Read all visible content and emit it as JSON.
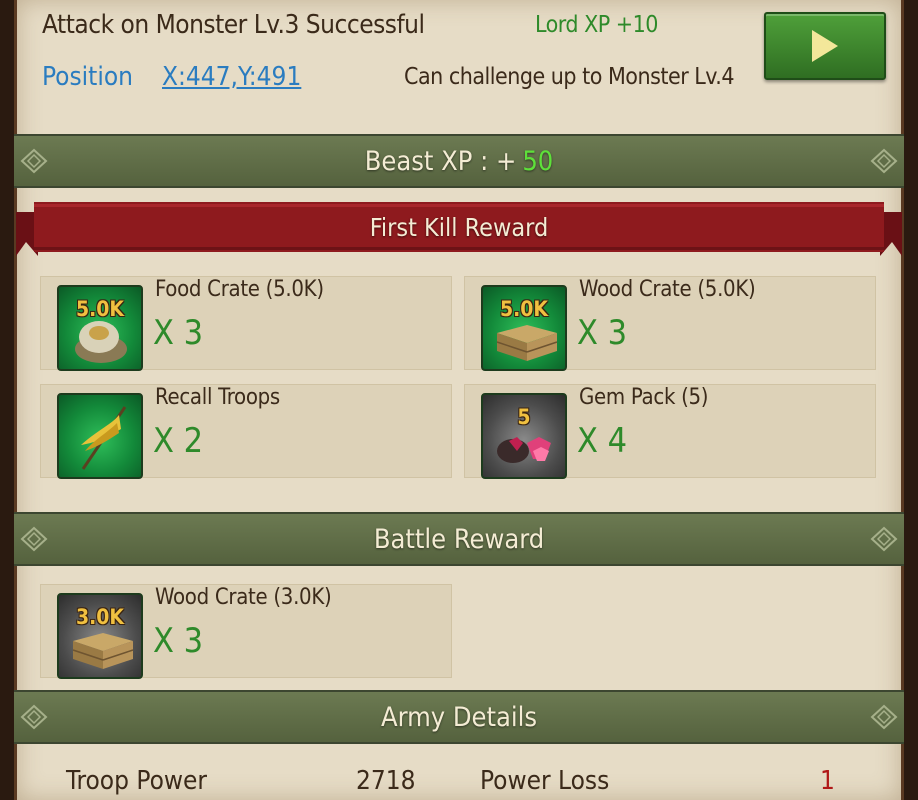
{
  "header": {
    "title": "Attack on Monster Lv.3 Successful",
    "lord_xp": "Lord XP +10",
    "position_label": "Position",
    "position_value": "X:447,Y:491",
    "challenge_text": "Can challenge up to Monster Lv.4"
  },
  "beast_xp": {
    "label": "Beast XP : +",
    "value": "50"
  },
  "first_kill": {
    "title": "First Kill Reward",
    "items": [
      {
        "qty": "5.0K",
        "name": "Food Crate (5.0K)",
        "count": "X 3",
        "icon": "food-crate-icon"
      },
      {
        "qty": "5.0K",
        "name": "Wood Crate (5.0K)",
        "count": "X 3",
        "icon": "wood-crate-icon"
      },
      {
        "qty": "",
        "name": "Recall Troops",
        "count": "X 2",
        "icon": "recall-flag-icon"
      },
      {
        "qty": "5",
        "name": "Gem Pack (5)",
        "count": "X 4",
        "icon": "gem-pack-icon"
      }
    ]
  },
  "battle_reward": {
    "title": "Battle Reward",
    "items": [
      {
        "qty": "3.0K",
        "name": "Wood Crate (3.0K)",
        "count": "X 3",
        "icon": "wood-crate-icon"
      }
    ]
  },
  "army_details": {
    "title": "Army Details",
    "troop_power_label": "Troop Power",
    "troop_power_value": "2718",
    "power_loss_label": "Power Loss",
    "power_loss_value": "1"
  },
  "colors": {
    "accent_green": "#2e8a2a",
    "link_blue": "#2a7cc0",
    "ribbon_red": "#8e1a1e",
    "bar_green": "#5f6d48",
    "loss_red": "#b01818"
  }
}
